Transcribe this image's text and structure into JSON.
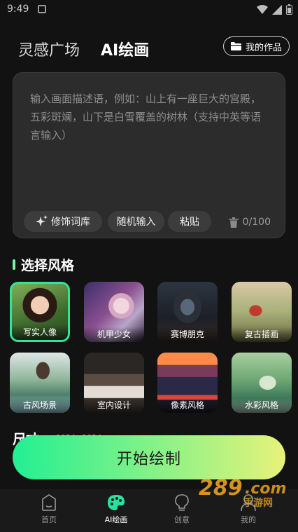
{
  "status_bar": {
    "time": "9:49"
  },
  "header": {
    "tab_inspiration": "灵感广场",
    "tab_ai_draw": "AI绘画",
    "my_works_label": "我的作品"
  },
  "prompt": {
    "placeholder": "输入画面描述语，例如：山上有一座巨大的宫殿，五彩斑斓，山下是白雪覆盖的树林（支持中英等语言输入）",
    "chips": {
      "modifier": "修饰词库",
      "random": "随机输入",
      "paste": "粘贴"
    },
    "counter": "0/100"
  },
  "styles": {
    "title": "选择风格",
    "items": [
      {
        "label": "写实人像",
        "selected": true
      },
      {
        "label": "机甲少女"
      },
      {
        "label": "赛博朋克"
      },
      {
        "label": "复古插画"
      },
      {
        "label": "古风场景"
      },
      {
        "label": "室内设计"
      },
      {
        "label": "像素风格"
      },
      {
        "label": "水彩风格"
      }
    ]
  },
  "next_section": {
    "title": "尺寸",
    "sub": "1024×1024"
  },
  "start_button": "开始绘制",
  "nav": {
    "home": "首页",
    "ai": "AI绘画",
    "idea": "创意",
    "mine": "我的"
  },
  "colors": {
    "accent_green": "#2ee59a",
    "button_start": "#22ef92",
    "button_end": "#e8f27a"
  }
}
